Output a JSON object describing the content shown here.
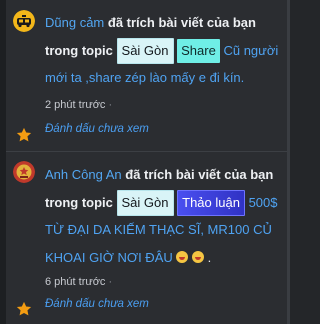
{
  "notifications": [
    {
      "user": "Dũng cảm",
      "action_1": "đã trích bài viết của bạn trong",
      "action_2": "topic",
      "tags": [
        "Sài Gòn",
        "Share"
      ],
      "title": "Cũ người mới ta ,share zép lào mấy e đi kín.",
      "time": "2 phút trước",
      "mark_label": "Đánh dấu chưa xem"
    },
    {
      "user": "Anh Công An",
      "action_1": "đã trích bài viết của bạn",
      "action_2": "trong topic",
      "tags": [
        "Sài Gòn",
        "Thảo luận"
      ],
      "title": "500$ TỪ ĐẠI DA KIẾM THẠC SĨ, MR100 CỦ KHOAI GIỜ NƠI ĐÂU",
      "time": "6 phút trước",
      "mark_label": "Đánh dấu chưa xem"
    }
  ],
  "icons": {
    "avatar_1": "taxi-avatar-icon",
    "avatar_2": "police-badge-avatar-icon",
    "star": "star-icon",
    "emoji": "grinning-face-emoji-icon"
  },
  "colors": {
    "background": "#242629",
    "username": "#53a7f2",
    "link": "#4fa3f2",
    "star": "#f39c12",
    "tag_saigon_bg": "#d9f4f7",
    "tag_share_bg": "#6feee6",
    "tag_thaoluan_bg": "#3d41e0"
  }
}
